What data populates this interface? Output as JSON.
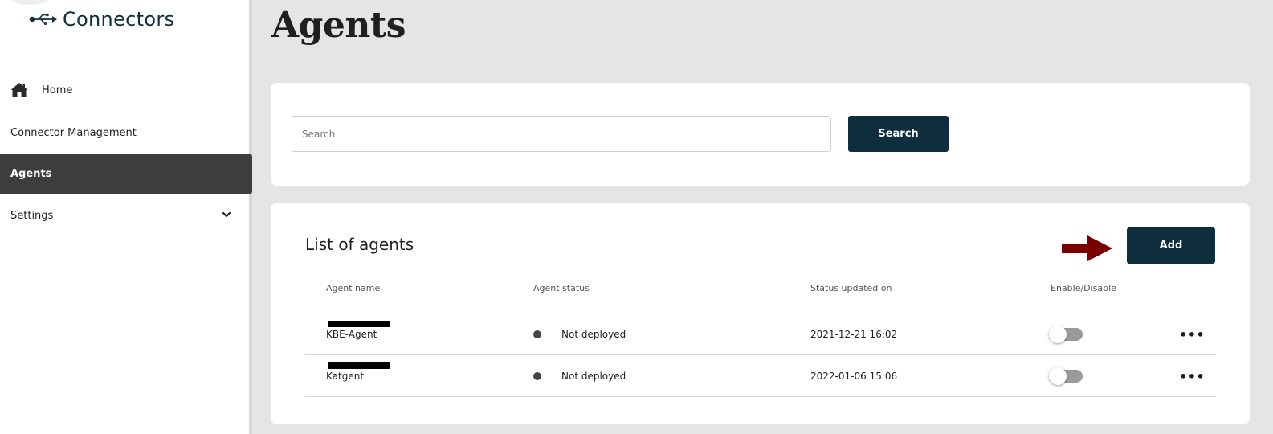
{
  "sidebar": {
    "brand": "Connectors",
    "items": [
      {
        "label": "Home",
        "icon": "home-icon"
      },
      {
        "label": "Connector Management"
      },
      {
        "label": "Agents",
        "active": true
      },
      {
        "label": "Settings",
        "icon": "chevron-down-icon"
      }
    ]
  },
  "page": {
    "title": "Agents"
  },
  "search": {
    "placeholder": "Search",
    "button_label": "Search"
  },
  "list": {
    "title": "List of agents",
    "add_label": "Add",
    "columns": [
      "Agent name",
      "Agent status",
      "Status updated on",
      "Enable/Disable"
    ],
    "rows": [
      {
        "name": "KBE-Agent",
        "status": "Not deployed",
        "updated": "2021-12-21 16:02",
        "enabled": false
      },
      {
        "name": "Katgent",
        "status": "Not deployed",
        "updated": "2022-01-06 15:06",
        "enabled": false
      }
    ]
  },
  "colors": {
    "primary": "#0e2d3d",
    "active_nav": "#3d3d3d",
    "annotation_arrow": "#7a0000",
    "background": "#e5e5e5"
  }
}
